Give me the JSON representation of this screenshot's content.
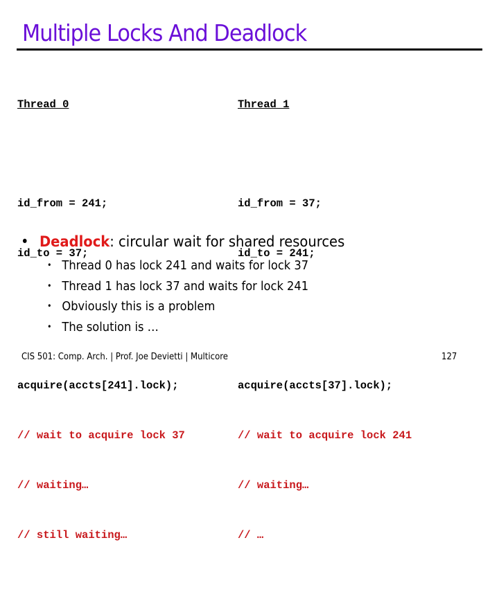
{
  "slide": {
    "title": "Multiple Locks And Deadlock",
    "threads": [
      {
        "header": "Thread 0",
        "assign": [
          "id_from = 241;",
          "id_to = 37;"
        ],
        "acquire": "acquire(accts[241].lock);",
        "comments": [
          "// wait to acquire lock 37",
          "// waiting…",
          "// still waiting…"
        ]
      },
      {
        "header": "Thread 1",
        "assign": [
          "id_from = 37;",
          "id_to = 241;"
        ],
        "acquire": "acquire(accts[37].lock);",
        "comments": [
          "// wait to acquire lock 241",
          "// waiting…",
          "// …"
        ]
      }
    ],
    "bullet": {
      "marker": "•",
      "keyword": "Deadlock",
      "rest": ": circular wait for shared resources",
      "sub_items": [
        "Thread 0 has lock 241 and waits for lock 37",
        "Thread 1 has lock 37 and waits for lock 241",
        "Obviously this is a problem",
        "The solution is …"
      ]
    },
    "footer": {
      "left": "CIS 501: Comp. Arch.  |  Prof. Joe Devietti  |  Multicore",
      "page": "127"
    },
    "colors": {
      "title": "#6a0fd8",
      "comment": "#c8181c",
      "keyword": "#e01a1a"
    }
  }
}
